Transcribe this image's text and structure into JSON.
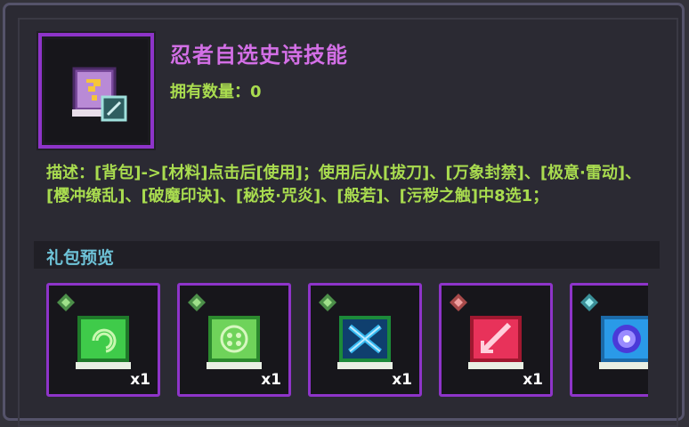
{
  "item": {
    "title": "忍者自选史诗技能",
    "quantity_text": "拥有数量：0",
    "description": "描述：[背包]->[材料]点击后[使用]；使用后从[拔刀]、[万象封禁]、[极意·雷动]、[樱冲缭乱]、[破魔印诀]、[秘技·咒炎]、[般若]、[污秽之触]中8选1；",
    "icon": "mystery-skill-book-icon"
  },
  "preview": {
    "label": "礼包预览",
    "slots": [
      {
        "icon": "green-swirl-skill-book-icon",
        "gem": "green-gem-icon",
        "count": "x1"
      },
      {
        "icon": "green-rune-skill-book-icon",
        "gem": "green-gem-icon",
        "count": "x1"
      },
      {
        "icon": "blue-cross-skill-book-icon",
        "gem": "green-gem-icon",
        "count": "x1"
      },
      {
        "icon": "red-slash-skill-book-icon",
        "gem": "red-gem-icon",
        "count": "x1"
      },
      {
        "icon": "blue-orb-skill-book-icon",
        "gem": "cyan-gem-icon",
        "count": ""
      }
    ]
  },
  "colors": {
    "title": "#d36fe6",
    "text_green": "#a9dc4f",
    "label_cyan": "#6ec3d8",
    "slot_border": "#8e34c9"
  }
}
